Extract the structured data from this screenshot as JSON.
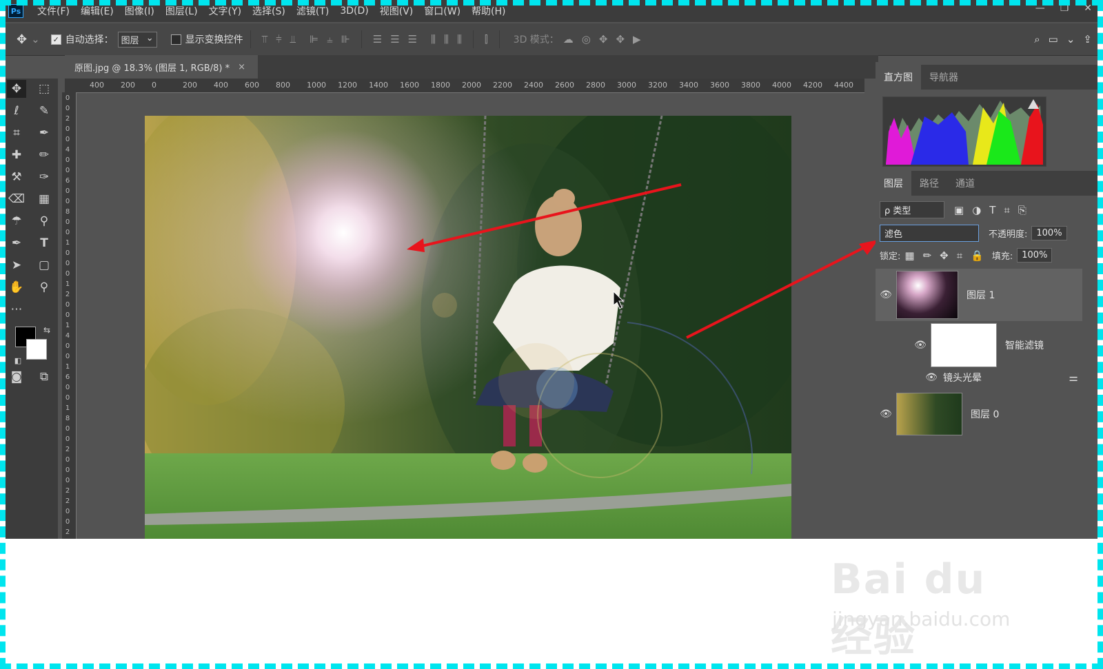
{
  "app": {
    "logo": "Ps"
  },
  "menu": [
    "文件(F)",
    "编辑(E)",
    "图像(I)",
    "图层(L)",
    "文字(Y)",
    "选择(S)",
    "滤镜(T)",
    "3D(D)",
    "视图(V)",
    "窗口(W)",
    "帮助(H)"
  ],
  "options": {
    "auto_select_label": "自动选择：",
    "auto_select_value": "图层",
    "show_transform_label": "显示变换控件",
    "mode_3d_label": "3D 模式："
  },
  "document": {
    "tab_title": "原图.jpg @ 18.3% (图层 1, RGB/8) *",
    "close": "×"
  },
  "ruler": {
    "h_ticks": [
      "400",
      "200",
      "0",
      "200",
      "400",
      "600",
      "800",
      "1000",
      "1200",
      "1400",
      "1600",
      "1800",
      "2000",
      "2200",
      "2400",
      "2600",
      "2800",
      "3000",
      "3200",
      "3400",
      "3600",
      "3800",
      "4000",
      "4200",
      "4400"
    ],
    "v_ticks": [
      "0",
      "0",
      "2",
      "0",
      "0",
      "4",
      "0",
      "0",
      "6",
      "0",
      "0",
      "8",
      "0",
      "0",
      "1",
      "0",
      "0",
      "0",
      "1",
      "2",
      "0",
      "0",
      "1",
      "4",
      "0",
      "0",
      "1",
      "6",
      "0",
      "0",
      "1",
      "8",
      "0",
      "0",
      "2",
      "0",
      "0",
      "0",
      "2",
      "2",
      "0",
      "0",
      "2"
    ]
  },
  "panels": {
    "top_tabs": [
      "直方图",
      "导航器"
    ],
    "layer_tabs": [
      "图层",
      "路径",
      "通道"
    ],
    "kind_filter": "ρ 类型",
    "blend_mode": "滤色",
    "opacity_label": "不透明度:",
    "opacity_value": "100%",
    "lock_label": "锁定:",
    "fill_label": "填充:",
    "fill_value": "100%"
  },
  "layers": [
    {
      "name": "图层 1"
    },
    {
      "name": "智能滤镜"
    },
    {
      "name": "镜头光晕"
    },
    {
      "name": "图层 0"
    }
  ],
  "watermark": {
    "logo": "Bai du 经验",
    "url": "jingyan.baidu.com"
  },
  "colors": {
    "accent_arrow": "#e8141c",
    "frame": "#00e5ee"
  }
}
